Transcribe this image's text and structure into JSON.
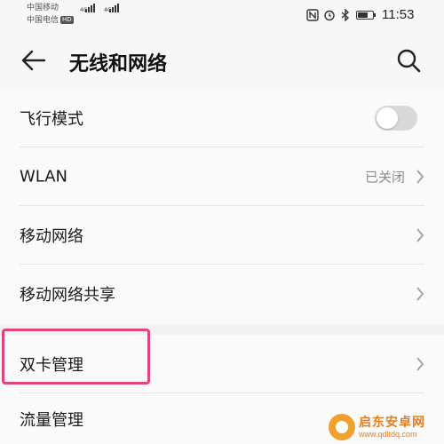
{
  "status_bar": {
    "carrier1": "中国移动",
    "carrier2": "中国电信",
    "hd_badge": "HD",
    "network1": "4G",
    "network2": "4G",
    "icons": [
      "nfc-icon",
      "alarm-icon",
      "bluetooth-icon",
      "battery-icon"
    ],
    "battery_level": 0.7,
    "time": "11:53"
  },
  "header": {
    "title": "无线和网络",
    "back_icon": "back-arrow-icon",
    "search_icon": "search-icon"
  },
  "settings": {
    "items": [
      {
        "label": "飞行模式",
        "control": "toggle",
        "enabled": false
      },
      {
        "label": "WLAN",
        "value": "已关闭",
        "control": "chevron"
      },
      {
        "label": "移动网络",
        "control": "chevron"
      },
      {
        "label": "移动网络共享",
        "control": "chevron"
      },
      {
        "label": "双卡管理",
        "control": "chevron",
        "highlighted": true
      },
      {
        "label": "流量管理",
        "control": "none"
      }
    ]
  },
  "watermark": {
    "text": "启东安卓网",
    "url": "www.qdltdq.com"
  },
  "colors": {
    "highlight": "#e0457b",
    "background": "#f2f2f2",
    "toggle_off": "#d9d9d9",
    "watermark": "#e07f1f"
  }
}
